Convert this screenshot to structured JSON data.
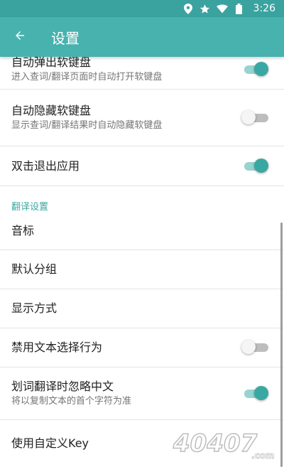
{
  "status_bar": {
    "time": "3:26"
  },
  "toolbar": {
    "title": "设置"
  },
  "rows": [
    {
      "title": "自动弹出软键盘",
      "subtitle": "进入查词/翻译页面时自动打开软键盘",
      "toggle": "on"
    },
    {
      "title": "自动隐藏软键盘",
      "subtitle": "显示查词/翻译结果时自动隐藏软键盘",
      "toggle": "off"
    },
    {
      "title": "双击退出应用",
      "toggle": "on"
    }
  ],
  "section": {
    "title": "翻译设置"
  },
  "translate_rows": [
    {
      "title": "音标"
    },
    {
      "title": "默认分组"
    },
    {
      "title": "显示方式"
    },
    {
      "title": "禁用文本选择行为",
      "toggle": "off"
    },
    {
      "title": "划词翻译时忽略中文",
      "subtitle": "将以复制文本的首个字符为准",
      "toggle": "on"
    },
    {
      "title": "使用自定义Key"
    }
  ],
  "watermark": {
    "text": "40407.com"
  },
  "colors": {
    "accent": "#48b2ae",
    "switch_on": "#3aa8a2",
    "section": "#3aa8a2"
  }
}
